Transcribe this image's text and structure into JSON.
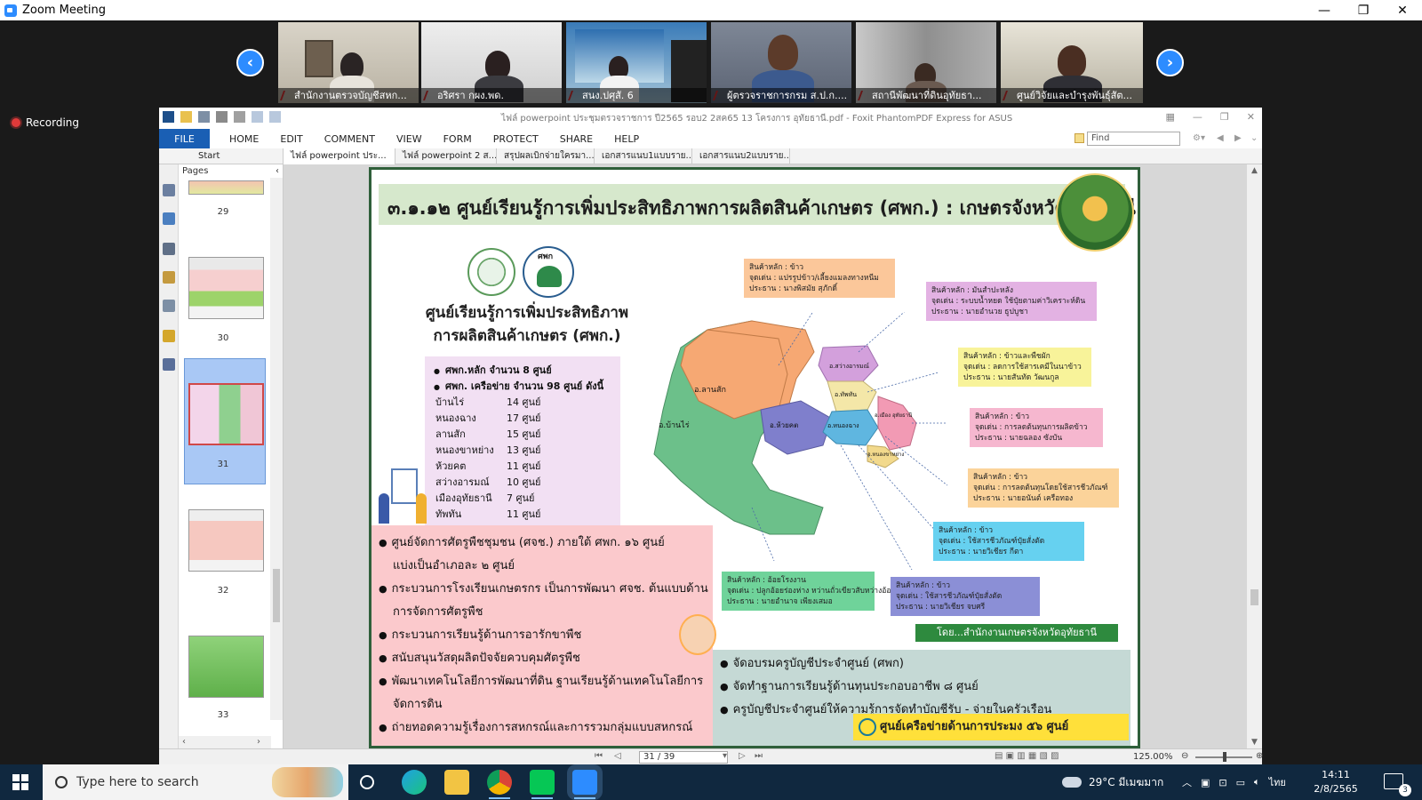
{
  "zoom": {
    "title": "Zoom Meeting",
    "recording_label": "Recording",
    "prev_arrow": "‹",
    "next_arrow": "›",
    "window_controls": [
      "—",
      "❐",
      "✕"
    ],
    "participants": [
      {
        "name": "สำนักงานตรวจบัญชีสหก..."
      },
      {
        "name": "อริศรา กผง.พด."
      },
      {
        "name": "สนง.ปศุสั. 6"
      },
      {
        "name": "ผู้ตรวจราชการกรม ส.ป.ก...."
      },
      {
        "name": "สถานีพัฒนาที่ดินอุทัยธา..."
      },
      {
        "name": "ศูนย์วิจัยและบำรุงพันธุ์สัต..."
      }
    ]
  },
  "foxit": {
    "title": "ไฟล์ powerpoint ประชุมตรวจราชการ ปี2565 รอบ2 2สค65 13 โครงการ อุทัยธานี.pdf - Foxit PhantomPDF Express for ASUS",
    "menu": [
      "FILE",
      "HOME",
      "EDIT",
      "COMMENT",
      "VIEW",
      "FORM",
      "PROTECT",
      "SHARE",
      "HELP"
    ],
    "find_placeholder": "Find",
    "tabs": [
      {
        "label": "Start"
      },
      {
        "label": "ไฟล์ powerpoint ประ..."
      },
      {
        "label": "ไฟล์ powerpoint 2 ส..."
      },
      {
        "label": "สรุปผลเบิกจ่ายใครมา..."
      },
      {
        "label": "เอกสารแนบ1แบบราย..."
      },
      {
        "label": "เอกสารแนบ2แบบราย..."
      }
    ],
    "tab_close": "✕",
    "pages_panel": {
      "label": "Pages",
      "collapse": "‹",
      "thumbs": [
        {
          "num": "29"
        },
        {
          "num": "30"
        },
        {
          "num": "31"
        },
        {
          "num": "32"
        },
        {
          "num": "33"
        }
      ]
    },
    "status": {
      "page_value": "31 / 39",
      "zoom": "125.00%"
    }
  },
  "slide": {
    "title": "๓.๑.๑๒ ศูนย์เรียนรู้การเพิ่มประสิทธิภาพการผลิตสินค้าเกษตร (ศพก.) : เกษตรจังหวัดอุทัยธานี",
    "logo_label": "ศพก",
    "center_title_1": "ศูนย์เรียนรู้การเพิ่มประสิทธิภาพ",
    "center_title_2": "การผลิตสินค้าเกษตร (ศพก.)",
    "bullet_main": "ศพก.หลัก จำนวน 8 ศูนย์",
    "bullet_network": "ศพก. เครือข่าย จำนวน 98 ศูนย์ ดังนี้",
    "districts": [
      {
        "name": "บ้านไร่",
        "count": "14 ศูนย์"
      },
      {
        "name": "หนองฉาง",
        "count": "17 ศูนย์"
      },
      {
        "name": "ลานสัก",
        "count": "15 ศูนย์"
      },
      {
        "name": "หนองขาหย่าง",
        "count": "13 ศูนย์"
      },
      {
        "name": "ห้วยคต",
        "count": "11 ศูนย์"
      },
      {
        "name": "สว่างอารมณ์",
        "count": "10 ศูนย์"
      },
      {
        "name": "เมืองอุทัยธานี",
        "count": "7 ศูนย์"
      },
      {
        "name": "ทัพทัน",
        "count": "11 ศูนย์"
      }
    ],
    "pink_items": [
      "ศูนย์จัดการศัตรูพืชชุมชน (ศจช.) ภายใต้ ศพก. ๑๖ ศูนย์",
      "แบ่งเป็นอำเภอละ ๒ ศูนย์",
      "กระบวนการโรงเรียนเกษตรกร เป็นการพัฒนา ศจช. ต้นแบบด้าน",
      "การจัดการศัตรูพืช",
      "กระบวนการเรียนรู้ด้านการอารักขาพืช",
      "สนับสนุนวัสดุผลิตปัจจัยควบคุมศัตรูพืช",
      "พัฒนาเทคโนโลยีการพัฒนาที่ดิน ฐานเรียนรู้ด้านเทคโนโลยีการ",
      "จัดการดิน",
      "ถ่ายทอดความรู้เรื่องการสหกรณ์และการรวมกลุ่มแบบสหกรณ์"
    ],
    "teal_items": [
      "จัดอบรมครูบัญชีประจำศูนย์ (ศพก)",
      "จัดทำฐานการเรียนรู้ด้านทุนประกอบอาชีพ ๘ ศูนย์",
      "ครูบัญชีประจำศูนย์ให้ความรู้การจัดทำบัญชีรับ - จ่ายในครัวเรือน"
    ],
    "yellow_bar": "ศูนย์เครือข่ายด้านการประมง ๕๖ ศูนย์",
    "source": "โดย...สำนักงานเกษตรจังหวัดอุทัยธานี",
    "map_labels": {
      "lansak": "อ.ลานสัก",
      "banrai": "อ.บ้านไร่",
      "huaikhot": "อ.ห้วยคต",
      "nongchang": "อ.หนองฉาง",
      "sawang": "อ.สว่างอารมณ์",
      "thapthan": "อ.ทัพทัน",
      "mueang": "อ.เมือง อุทัยธานี",
      "nongkhayang": "อ.หนองขาหย่าง"
    },
    "info_boxes": [
      {
        "l1": "สินค้าหลัก : ข้าว",
        "l2": "จุดเด่น : แปรรูปข้าว/เลี้ยงแมลงทางหนีม",
        "l3": "ประธาน : นางพิสมัย สุภักดิ์",
        "color": "#fbc79a"
      },
      {
        "l1": "สินค้าหลัก : มันสำปะหลัง",
        "l2": "จุดเด่น : ระบบน้ำหยด ใช้ปุ๋ยตามค่าวิเคราะห์ดิน",
        "l3": "ประธาน : นายอำนวย ธูปบูชา",
        "color": "#e3b2e3"
      },
      {
        "l1": "สินค้าหลัก : ข้าวและพืชผัก",
        "l2": "จุดเด่น : ลดการใช้สารเคมีในนาข้าว",
        "l3": "ประธาน : นายสันทัด วัฒนกูล",
        "color": "#f8f39a"
      },
      {
        "l1": "สินค้าหลัก : ข้าว",
        "l2": "จุดเด่น : การลดต้นทุนการผลิตข้าว",
        "l3": "ประธาน : นายฉลอง ซังบัน",
        "color": "#f6b7cf"
      },
      {
        "l1": "สินค้าหลัก : ข้าว",
        "l2": "จุดเด่น : การลดต้นทุนโดยใช้สารชีวภัณฑ์",
        "l3": "ประธาน : นายอนันต์ เครือทอง",
        "color": "#fbd39a"
      },
      {
        "l1": "สินค้าหลัก : ข้าว",
        "l2": "จุดเด่น : ใช้สารชีวภัณฑ์ปุ๋ยสั่งตัด",
        "l3": "ประธาน : นายวิเชียร กีตา",
        "color": "#66d1f0"
      },
      {
        "l1": "สินค้าหลัก : อ้อยโรงงาน",
        "l2": "จุดเด่น : ปลูกอ้อยร่องห่าง หว่านถั่วเขียวสับหว่างอ้อย",
        "l3": "ประธาน : นายอำนาจ เพียงเสมอ",
        "color": "#6fd39a"
      },
      {
        "l1": "สินค้าหลัก : ข้าว",
        "l2": "จุดเด่น : ใช้สารชีวภัณฑ์ปุ๋ยสั่งตัด",
        "l3": "ประธาน : นายวิเชียร จบศรี",
        "color": "#8b8fd6"
      }
    ]
  },
  "taskbar": {
    "search_placeholder": "Type here to search",
    "weather": "29°C มีเมฆมาก",
    "lang": "ไทย",
    "time": "14:11",
    "date": "2/8/2565",
    "notif_count": "3"
  }
}
